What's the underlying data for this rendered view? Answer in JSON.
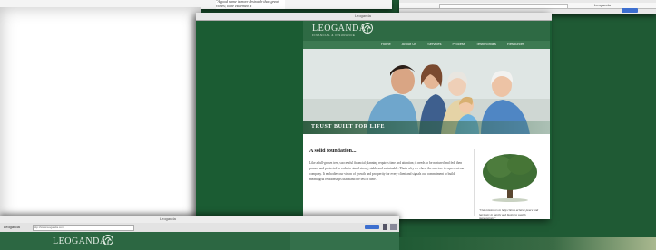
{
  "top_left_window": {
    "snippet_text": "\"A good name is more desirable than great riches; to be esteemed is"
  },
  "top_right_window": {
    "title": "Leoganda"
  },
  "main_window": {
    "title": "Leoganda",
    "site": {
      "logo": "LEOGANDA",
      "logo_sub": "FINANCIAL & INSURANCE",
      "nav": [
        "Home",
        "About Us",
        "Services",
        "Process",
        "Testimonials",
        "Resources"
      ],
      "tagline": "TRUST BUILT FOR LIFE",
      "heading": "A solid foundation...",
      "body": "Like a full-grown tree, successful financial planning requires time and attention; it needs to be nurtured and fed, then pruned and protected in order to stand strong, stable and sustainable. That's why we chose the oak tree to represent our company. It embodies our vision of growth and prosperity for every client and signals our commitment to build meaningful relationships that stand the test of time.",
      "quote": "\"Our mission is to help clients achieve peace and harmony in family and business wealth management\""
    }
  },
  "bottom_window": {
    "title": "Leoganda",
    "toolbar_label": "Leoganda",
    "address": "http://www.leoganda.com",
    "logo": "LEOGANDA"
  },
  "colors": {
    "brand_green": "#1f5a34",
    "header_green": "#2e6a44",
    "go_button": "#3d6fcf"
  }
}
